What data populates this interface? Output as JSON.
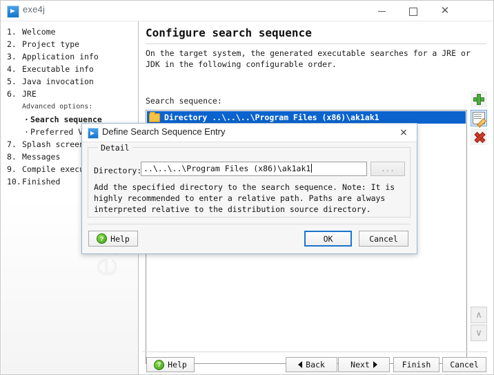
{
  "window": {
    "title": "exe4j",
    "icon": "exe4j-app-icon",
    "controls": {
      "minimize": "minimize-icon",
      "maximize": "maximize-icon",
      "close": "close-icon"
    }
  },
  "sidebar": {
    "steps": [
      {
        "num": "1.",
        "label": "Welcome"
      },
      {
        "num": "2.",
        "label": "Project type"
      },
      {
        "num": "3.",
        "label": "Application info"
      },
      {
        "num": "4.",
        "label": "Executable info"
      },
      {
        "num": "5.",
        "label": "Java invocation"
      },
      {
        "num": "6.",
        "label": "JRE"
      }
    ],
    "advanced_heading": "Advanced options:",
    "sub_items": [
      {
        "bullet": "·",
        "label": "Search sequence",
        "current": true
      },
      {
        "bullet": "·",
        "label": "Preferred VM",
        "current": false
      }
    ],
    "steps_after": [
      {
        "num": "7.",
        "label": "Splash screen"
      },
      {
        "num": "8.",
        "label": "Messages"
      },
      {
        "num": "9.",
        "label": "Compile executa"
      },
      {
        "num": "10.",
        "label": "Finished"
      }
    ],
    "watermark": "exe4j"
  },
  "main": {
    "page_title": "Configure search sequence",
    "intro": "On the target system, the generated executable searches for a JRE or JDK in the following configurable order.",
    "sequence_label": "Search sequence:",
    "list_items": [
      {
        "icon": "folder-icon",
        "text": "Directory ..\\..\\..\\Program Files (x86)\\ak1ak1",
        "selected": true
      }
    ],
    "tools": {
      "add": "add-icon",
      "edit": "edit-icon",
      "delete": "delete-icon",
      "move_up": "∧",
      "move_down": "∨"
    },
    "selection_color": "#0b63ce"
  },
  "bottom_bar": {
    "help": "Help",
    "back": "Back",
    "next": "Next",
    "finish": "Finish",
    "cancel": "Cancel"
  },
  "dialog": {
    "title": "Define Search Sequence Entry",
    "close": "×",
    "group_legend": "Detail",
    "directory_label": "Directory:",
    "directory_value": "..\\..\\..\\Program Files (x86)\\ak1ak1",
    "browse_label": "...",
    "hint": "Add the specified directory to the search sequence. Note: It is highly recommended to enter a relative path. Paths are always interpreted relative to the distribution source directory.",
    "help": "Help",
    "ok": "OK",
    "cancel": "Cancel",
    "focus_color": "#1a74d0"
  }
}
